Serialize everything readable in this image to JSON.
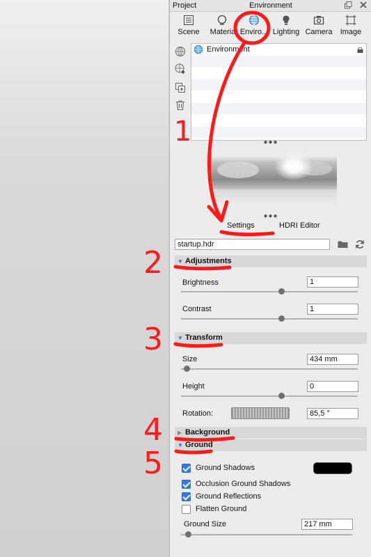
{
  "window": {
    "project_label": "Project",
    "title": "Environment",
    "restore_icon": "restore-window-icon",
    "close_icon": "close-icon"
  },
  "tabs": [
    {
      "label": "Scene",
      "icon": "scene-list-icon"
    },
    {
      "label": "Materia",
      "icon": "material-ball-icon"
    },
    {
      "label": "Enviro...",
      "icon": "globe-icon",
      "selected": true
    },
    {
      "label": "Lighting",
      "icon": "bulb-icon"
    },
    {
      "label": "Camera",
      "icon": "camera-icon"
    },
    {
      "label": "Image",
      "icon": "image-crop-icon"
    }
  ],
  "environment_list": {
    "items": [
      {
        "label": "Environment",
        "icon": "globe-icon",
        "locked": true
      }
    ]
  },
  "subtabs": {
    "settings": "Settings",
    "hdri_editor": "HDRI Editor",
    "selected": "Settings"
  },
  "file": {
    "value": "startup.hdr"
  },
  "adjustments": {
    "title": "Adjustments",
    "brightness": {
      "label": "Brightness",
      "value": "1",
      "slider": 0.5
    },
    "contrast": {
      "label": "Contrast",
      "value": "1",
      "slider": 0.5
    }
  },
  "transform": {
    "title": "Transform",
    "size": {
      "label": "Size",
      "value": "434 mm",
      "slider": 0.0
    },
    "height": {
      "label": "Height",
      "value": "0",
      "slider": 0.5
    },
    "rotation": {
      "label": "Rotation:",
      "value": "85,5 °"
    }
  },
  "background": {
    "title": "Background"
  },
  "ground": {
    "title": "Ground",
    "ground_shadows": {
      "label": "Ground Shadows",
      "checked": true,
      "color": "#000000"
    },
    "occlusion_ground_shadows": {
      "label": "Occlusion Ground Shadows",
      "checked": true
    },
    "ground_reflections": {
      "label": "Ground Reflections",
      "checked": true
    },
    "flatten_ground": {
      "label": "Flatten Ground",
      "checked": false
    },
    "ground_size": {
      "label": "Ground Size",
      "value": "217 mm",
      "slider": 0.0
    }
  },
  "annotations": {
    "n1": "1",
    "n2": "2",
    "n3": "3",
    "n4": "4",
    "n5": "5",
    "color": "#ff1a1a"
  }
}
